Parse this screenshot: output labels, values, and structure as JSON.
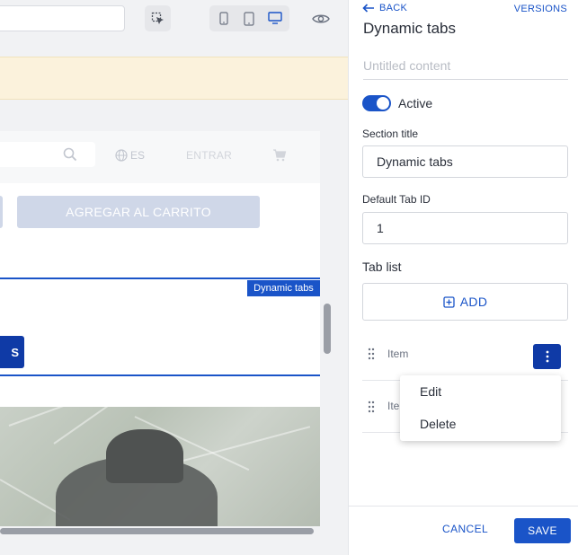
{
  "colors": {
    "accent": "#1a54c8",
    "dark_accent": "#0f3aa6",
    "banner": "#fbf2dc"
  },
  "preview": {
    "toolbar": {
      "url_value": "",
      "icons": [
        "cursor-select-icon",
        "mobile-icon",
        "tablet-icon",
        "desktop-icon",
        "eye-icon"
      ],
      "active_device": "desktop"
    },
    "site": {
      "language": "ES",
      "login": "ENTRAR",
      "add_to_cart": "AGREGAR AL CARRITO",
      "selection_tag": "Dynamic tabs",
      "tab_button_text": "S"
    }
  },
  "panel": {
    "back_label": "BACK",
    "versions_label": "VERSIONS",
    "title": "Dynamic tabs",
    "content_name_placeholder": "Untitled content",
    "active_label": "Active",
    "active_on": true,
    "section_title_label": "Section title",
    "section_title_value": "Dynamic tabs",
    "default_tab_label": "Default Tab ID",
    "default_tab_value": "1",
    "tab_list_label": "Tab list",
    "add_label": "ADD",
    "items": [
      {
        "label": "Item"
      },
      {
        "label": "Item"
      }
    ],
    "context_menu": {
      "edit": "Edit",
      "delete": "Delete"
    },
    "footer": {
      "cancel": "CANCEL",
      "save": "SAVE"
    }
  }
}
